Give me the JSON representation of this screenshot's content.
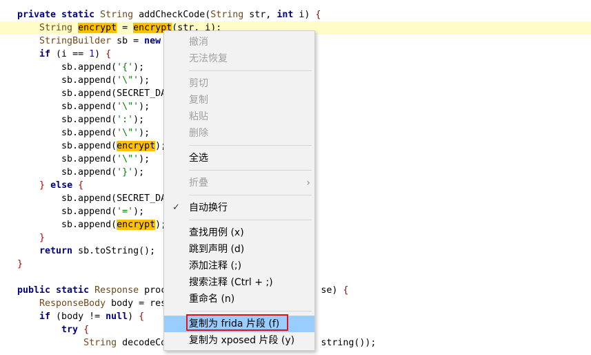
{
  "code": {
    "l1": [
      {
        "t": "private static",
        "c": "kw"
      },
      {
        "t": " "
      },
      {
        "t": "String",
        "c": "ty"
      },
      {
        "t": " addCheckCode("
      },
      {
        "t": "String",
        "c": "ty"
      },
      {
        "t": " str, "
      },
      {
        "t": "int",
        "c": "kw"
      },
      {
        "t": " i) "
      },
      {
        "t": "{",
        "c": "br"
      }
    ],
    "l2": [
      {
        "t": "    "
      },
      {
        "t": "String",
        "c": "ty"
      },
      {
        "t": " "
      },
      {
        "t": "encrypt",
        "c": "mark"
      },
      {
        "t": " = "
      },
      {
        "t": "encrypt",
        "c": "mark"
      },
      {
        "t": "(str, i);"
      }
    ],
    "l3": [
      {
        "t": "    "
      },
      {
        "t": "StringBuilder",
        "c": "ty"
      },
      {
        "t": " sb = "
      },
      {
        "t": "new",
        "c": "kw"
      }
    ],
    "l4": [
      {
        "t": "    "
      },
      {
        "t": "if",
        "c": "kw"
      },
      {
        "t": " (i == "
      },
      {
        "t": "1",
        "c": "num"
      },
      {
        "t": ") "
      },
      {
        "t": "{",
        "c": "br"
      }
    ],
    "l5": [
      {
        "t": "        sb.append("
      },
      {
        "t": "'{'",
        "c": "str"
      },
      {
        "t": ");"
      }
    ],
    "l6": [
      {
        "t": "        sb.append("
      },
      {
        "t": "'\\\"'",
        "c": "str"
      },
      {
        "t": ");"
      }
    ],
    "l7": [
      {
        "t": "        sb.append(SECRET_DA"
      }
    ],
    "l8": [
      {
        "t": "        sb.append("
      },
      {
        "t": "'\\\"'",
        "c": "str"
      },
      {
        "t": ");"
      }
    ],
    "l9": [
      {
        "t": "        sb.append("
      },
      {
        "t": "':'",
        "c": "str"
      },
      {
        "t": ");"
      }
    ],
    "l10": [
      {
        "t": "        sb.append("
      },
      {
        "t": "'\\\"'",
        "c": "str"
      },
      {
        "t": ");"
      }
    ],
    "l11": [
      {
        "t": "        sb.append("
      },
      {
        "t": "encrypt",
        "c": "mark"
      },
      {
        "t": ");"
      }
    ],
    "l12": [
      {
        "t": "        sb.append("
      },
      {
        "t": "'\\\"'",
        "c": "str"
      },
      {
        "t": ");"
      }
    ],
    "l13": [
      {
        "t": "        sb.append("
      },
      {
        "t": "'}'",
        "c": "str"
      },
      {
        "t": ");"
      }
    ],
    "l14": [
      {
        "t": "    "
      },
      {
        "t": "}",
        "c": "br"
      },
      {
        "t": " "
      },
      {
        "t": "else",
        "c": "kw"
      },
      {
        "t": " "
      },
      {
        "t": "{",
        "c": "br"
      }
    ],
    "l15": [
      {
        "t": "        sb.append(SECRET_DA"
      }
    ],
    "l16": [
      {
        "t": "        sb.append("
      },
      {
        "t": "'='",
        "c": "str"
      },
      {
        "t": ");"
      }
    ],
    "l17": [
      {
        "t": "        sb.append("
      },
      {
        "t": "encrypt",
        "c": "mark"
      },
      {
        "t": ");"
      }
    ],
    "l18": [
      {
        "t": "    "
      },
      {
        "t": "}",
        "c": "br"
      }
    ],
    "l19": [
      {
        "t": "    "
      },
      {
        "t": "return",
        "c": "kw"
      },
      {
        "t": " sb.toString();"
      }
    ],
    "l20": [
      {
        "t": "}",
        "c": "br"
      }
    ],
    "l21": [],
    "l22": [
      {
        "t": "public static",
        "c": "kw"
      },
      {
        "t": " "
      },
      {
        "t": "Response",
        "c": "ty"
      },
      {
        "t": " proc"
      },
      {
        "t": "                            "
      },
      {
        "t": "se) "
      },
      {
        "t": "{",
        "c": "br"
      }
    ],
    "l23": [
      {
        "t": "    "
      },
      {
        "t": "ResponseBody",
        "c": "ty"
      },
      {
        "t": " body = res"
      }
    ],
    "l24": [
      {
        "t": "    "
      },
      {
        "t": "if",
        "c": "kw"
      },
      {
        "t": " (body != "
      },
      {
        "t": "null",
        "c": "kw"
      },
      {
        "t": ") "
      },
      {
        "t": "{",
        "c": "br"
      }
    ],
    "l25": [
      {
        "t": "        "
      },
      {
        "t": "try",
        "c": "kw"
      },
      {
        "t": " "
      },
      {
        "t": "{",
        "c": "br"
      }
    ],
    "l26": [
      {
        "t": "            "
      },
      {
        "t": "String",
        "c": "ty"
      },
      {
        "t": " decodeCo"
      },
      {
        "t": "                            "
      },
      {
        "t": "string());"
      }
    ]
  },
  "context_menu": {
    "undo": "撤消",
    "redo": "无法恢复",
    "cut": "剪切",
    "copy": "复制",
    "paste": "粘贴",
    "delete": "删除",
    "select_all": "全选",
    "fold": "折叠",
    "word_wrap": "自动换行",
    "find_usage": "查找用例 (x)",
    "goto_decl": "跳到声明 (d)",
    "add_comment": "添加注释 (;)",
    "search_comment": "搜索注释 (Ctrl + ;)",
    "rename": "重命名 (n)",
    "copy_frida": "复制为 frida 片段 (f)",
    "copy_xposed": "复制为 xposed 片段 (y)"
  }
}
